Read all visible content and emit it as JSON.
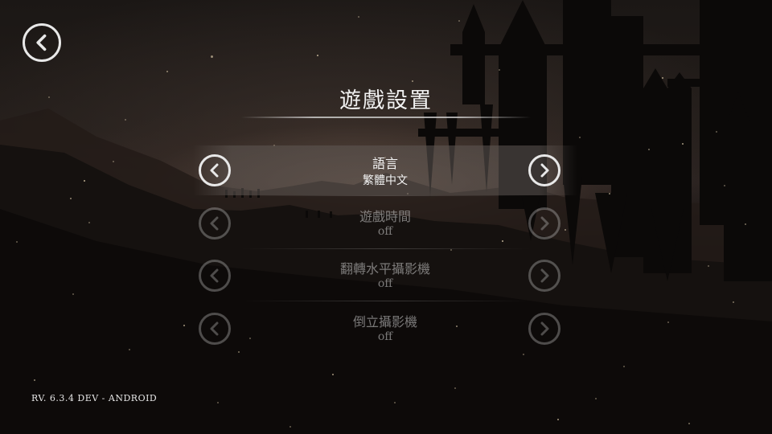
{
  "header": {
    "back_icon": "chevron-left-circle-icon",
    "title": "遊戲設置"
  },
  "settings": [
    {
      "name": "語言",
      "value": "繁體中文",
      "active": true
    },
    {
      "name": "遊戲時間",
      "value": "off",
      "active": false
    },
    {
      "name": "翻轉水平攝影機",
      "value": "off",
      "active": false
    },
    {
      "name": "倒立攝影機",
      "value": "off",
      "active": false
    }
  ],
  "icons": {
    "previous": "chevron-left-circle-icon",
    "next": "chevron-right-circle-icon"
  },
  "footer": {
    "version": "RV. 6.3.4 DEV - ANDROID"
  },
  "colors": {
    "background": "#1b1715",
    "text": "#f4f4f4",
    "dimmed": "#8c8c8c"
  }
}
